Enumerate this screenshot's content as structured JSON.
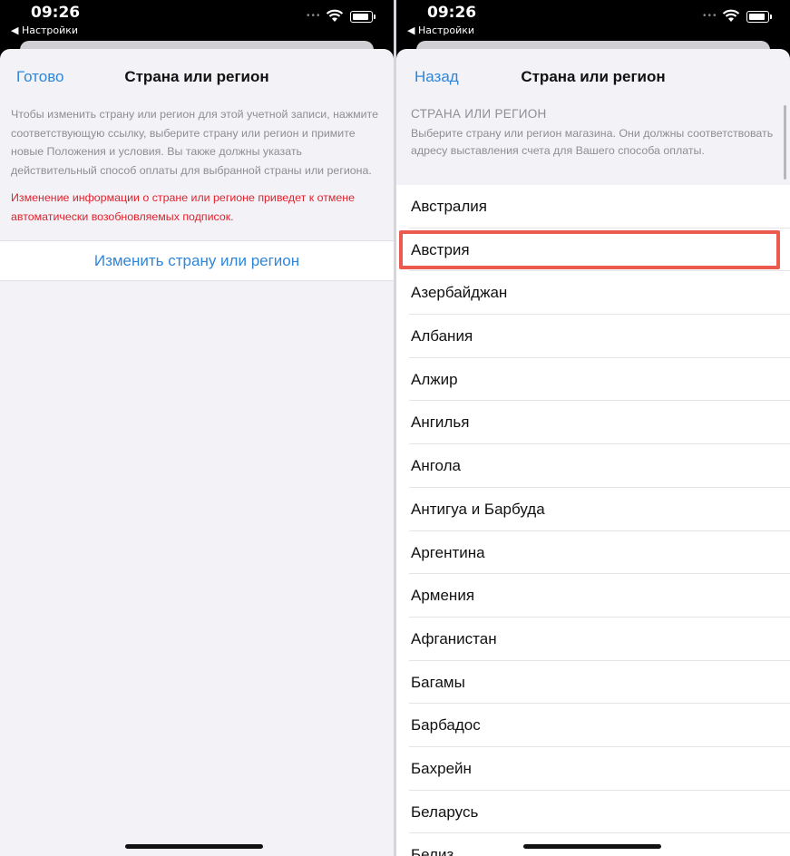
{
  "left": {
    "status": {
      "time": "09:26",
      "back_app": "◀ Настройки"
    },
    "nav": {
      "done_label": "Готово",
      "title": "Страна или регион"
    },
    "info_text": "Чтобы изменить страну или регион для этой учетной записи, нажмите соответствующую ссылку, выберите страну или регион и примите новые Положения и условия. Вы также должны указать действительный способ оплаты для выбранной страны или региона.",
    "warning_text": "Изменение информации о стране или регионе приведет к отмене автоматически возобновляемых подписок.",
    "change_link": "Изменить страну или регион"
  },
  "right": {
    "status": {
      "time": "09:26",
      "back_app": "◀ Настройки"
    },
    "nav": {
      "back_label": "Назад",
      "title": "Страна или регион"
    },
    "section_header": "СТРАНА ИЛИ РЕГИОН",
    "section_note": "Выберите страну или регион магазина. Они должны соответствовать адресу выставления счета для Вашего способа оплаты.",
    "countries": [
      "Австралия",
      "Австрия",
      "Азербайджан",
      "Албания",
      "Алжир",
      "Ангилья",
      "Ангола",
      "Антигуа и Барбуда",
      "Аргентина",
      "Армения",
      "Афганистан",
      "Багамы",
      "Барбадос",
      "Бахрейн",
      "Беларусь",
      "Белиз"
    ],
    "highlighted_country": "Австрия"
  },
  "colors": {
    "accent": "#2f86d8",
    "warning": "#e0232e",
    "highlight": "#ea5a4e"
  }
}
